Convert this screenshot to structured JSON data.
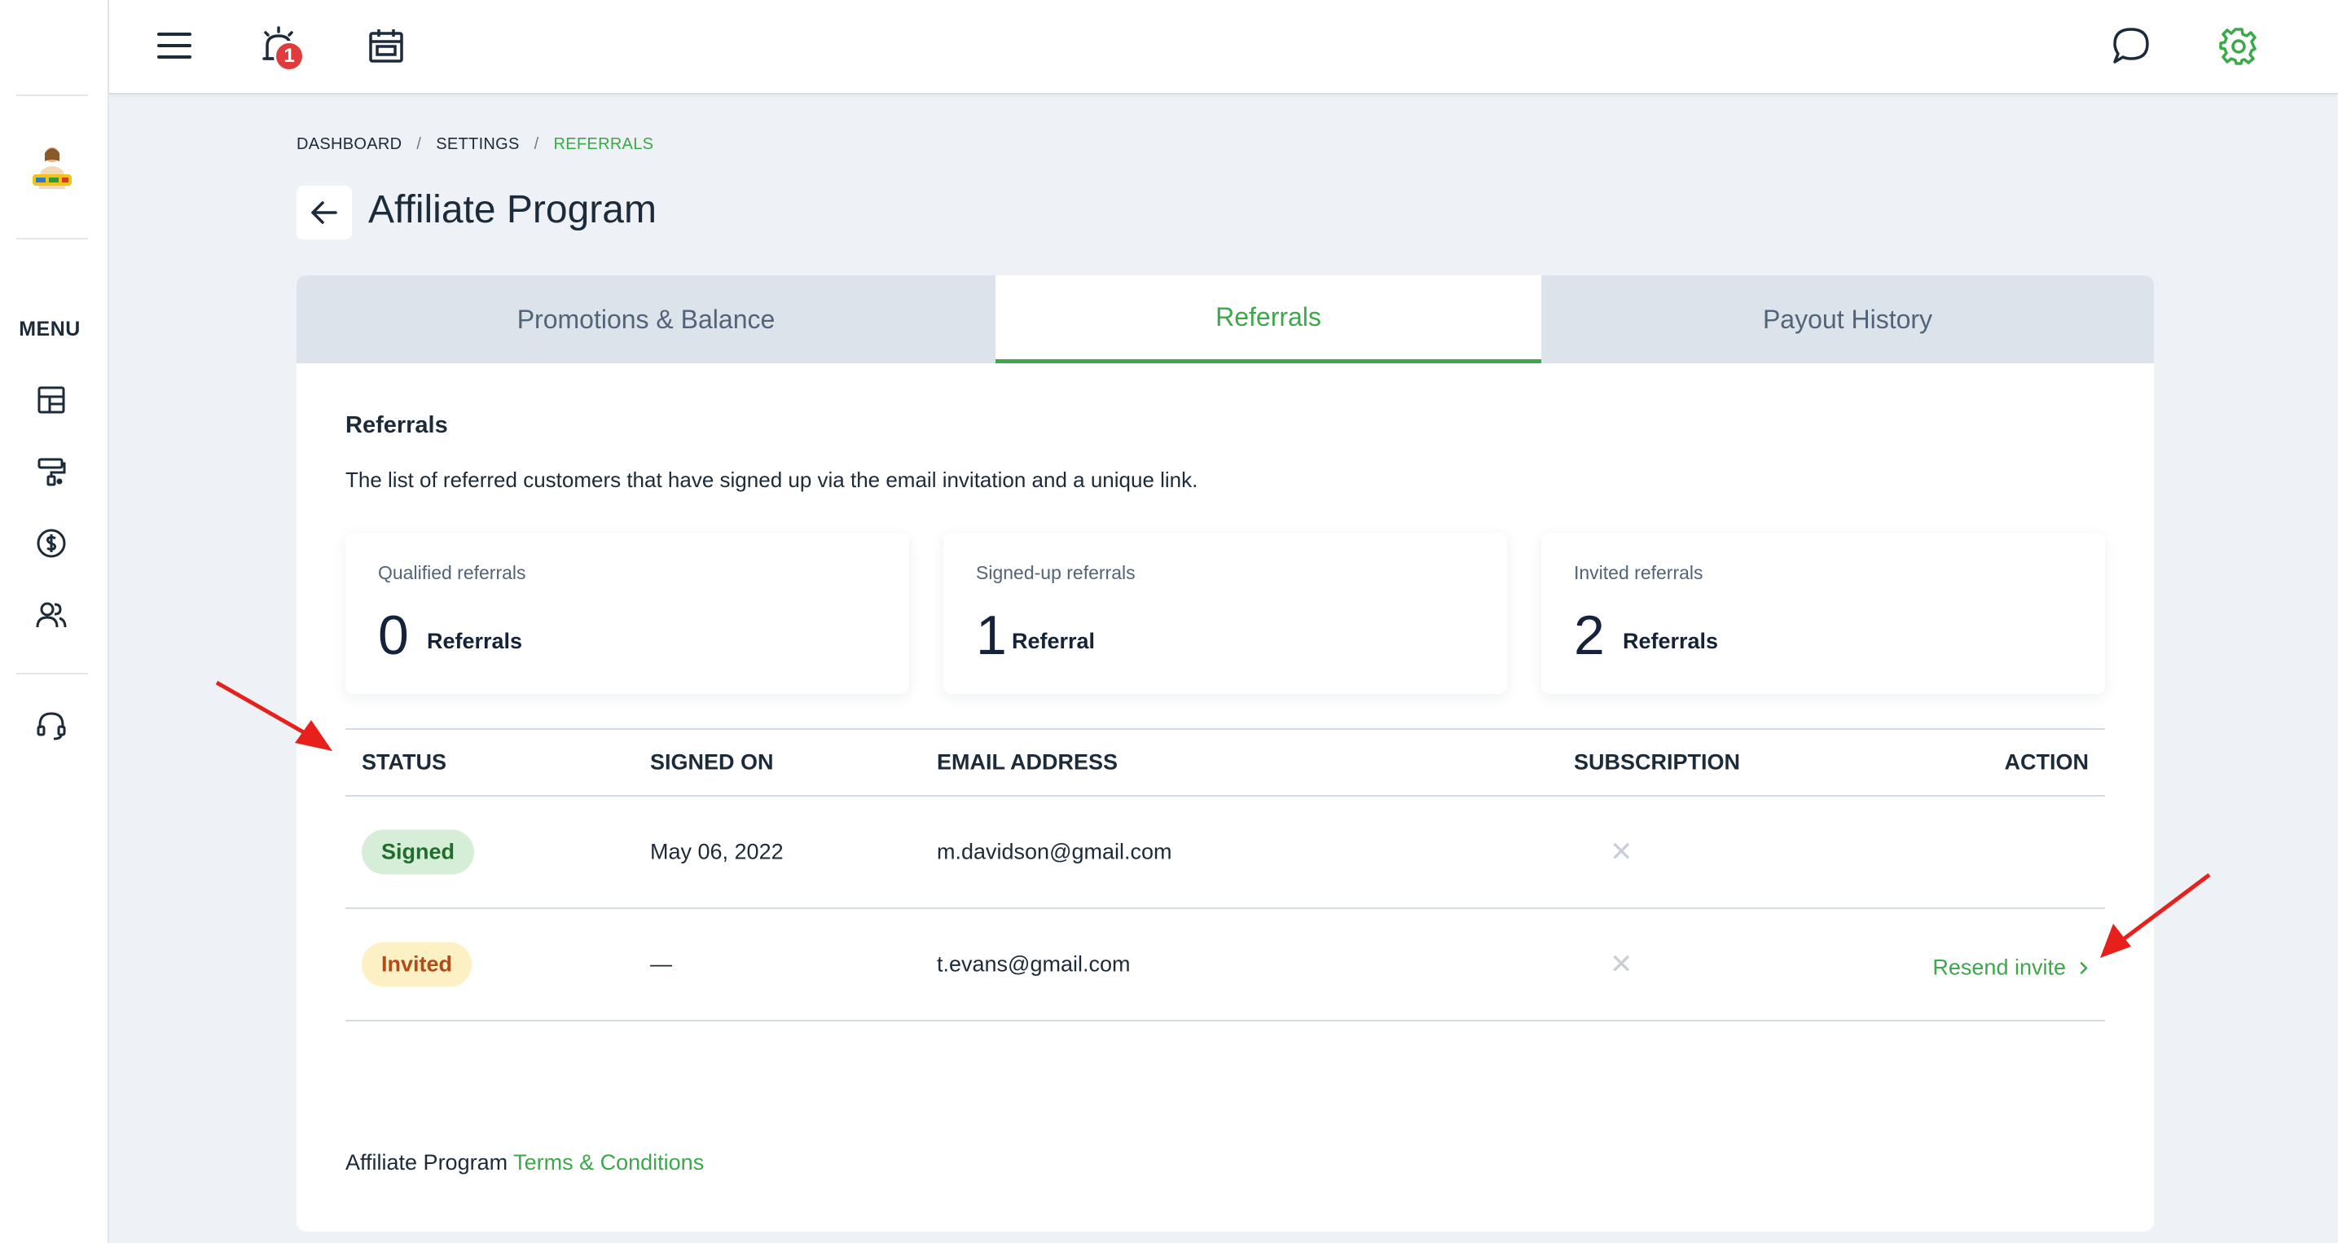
{
  "topbar": {
    "notification_count": "1"
  },
  "sidebar": {
    "menu_label": "MENU",
    "items": [
      {
        "icon": "dashboard-icon"
      },
      {
        "icon": "paint-roller-icon"
      },
      {
        "icon": "dollar-circle-icon"
      },
      {
        "icon": "users-icon"
      },
      {
        "icon": "headset-icon"
      }
    ]
  },
  "breadcrumb": {
    "items": [
      "DASHBOARD",
      "SETTINGS",
      "REFERRALS"
    ],
    "separator": "/"
  },
  "page": {
    "title": "Affiliate Program"
  },
  "tabs": [
    {
      "label": "Promotions & Balance",
      "active": false
    },
    {
      "label": "Referrals",
      "active": true
    },
    {
      "label": "Payout History",
      "active": false
    }
  ],
  "section": {
    "title": "Referrals",
    "description": "The list of referred customers that have signed up via the email invitation and a unique link."
  },
  "stats": [
    {
      "label": "Qualified referrals",
      "value": "0",
      "unit": "Referrals"
    },
    {
      "label": "Signed-up referrals",
      "value": "1",
      "unit": "Referral"
    },
    {
      "label": "Invited referrals",
      "value": "2",
      "unit": "Referrals"
    }
  ],
  "table": {
    "headers": {
      "status": "STATUS",
      "signed_on": "SIGNED ON",
      "email": "EMAIL ADDRESS",
      "subscription": "SUBSCRIPTION",
      "action": "ACTION"
    },
    "rows": [
      {
        "status": "Signed",
        "signed_on": "May 06, 2022",
        "email": "m.davidson@gmail.com",
        "subscription": "✕",
        "action": ""
      },
      {
        "status": "Invited",
        "signed_on": "—",
        "email": "t.evans@gmail.com",
        "subscription": "✕",
        "action": "Resend invite"
      }
    ]
  },
  "footer": {
    "prefix": "Affiliate Program",
    "link": "Terms & Conditions"
  },
  "colors": {
    "accent": "#3ba84a",
    "annotation_arrow": "#e8201c",
    "badge": "#e03c3c"
  }
}
